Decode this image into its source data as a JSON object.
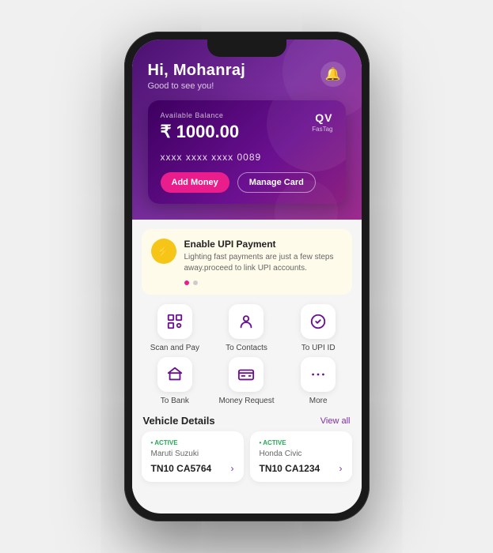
{
  "header": {
    "greeting": "Hi, Mohanraj",
    "subtext": "Good to see you!",
    "bell_icon": "🔔"
  },
  "card": {
    "balance_label": "Available Balance",
    "balance": "₹ 1000.00",
    "card_number": "xxxx xxxx xxxx 0089",
    "brand_logo": "QV",
    "brand_name": "FasTag",
    "add_money_label": "Add Money",
    "manage_card_label": "Manage Card"
  },
  "upi_banner": {
    "icon": "⚡",
    "title": "Enable UPI Payment",
    "description": "Lighting fast payments are just a few steps away.proceed to link UPI accounts."
  },
  "quick_actions": [
    {
      "id": "scan-pay",
      "label": "Scan and Pay",
      "icon": "⊞"
    },
    {
      "id": "to-contacts",
      "label": "To Contacts",
      "icon": "👤"
    },
    {
      "id": "to-upi-id",
      "label": "To UPI ID",
      "icon": "▶"
    },
    {
      "id": "to-bank",
      "label": "To Bank",
      "icon": "🏛"
    },
    {
      "id": "money-request",
      "label": "Money Request",
      "icon": "💳"
    },
    {
      "id": "more",
      "label": "More",
      "icon": "···"
    }
  ],
  "vehicle_section": {
    "title": "Vehicle Details",
    "view_all_label": "View all"
  },
  "vehicles": [
    {
      "status": "ACTIVE",
      "name": "Maruti Suzuki",
      "plate": "TN10 CA5764"
    },
    {
      "status": "ACTIVE",
      "name": "Honda Civic",
      "plate": "TN10 CA1234"
    }
  ]
}
